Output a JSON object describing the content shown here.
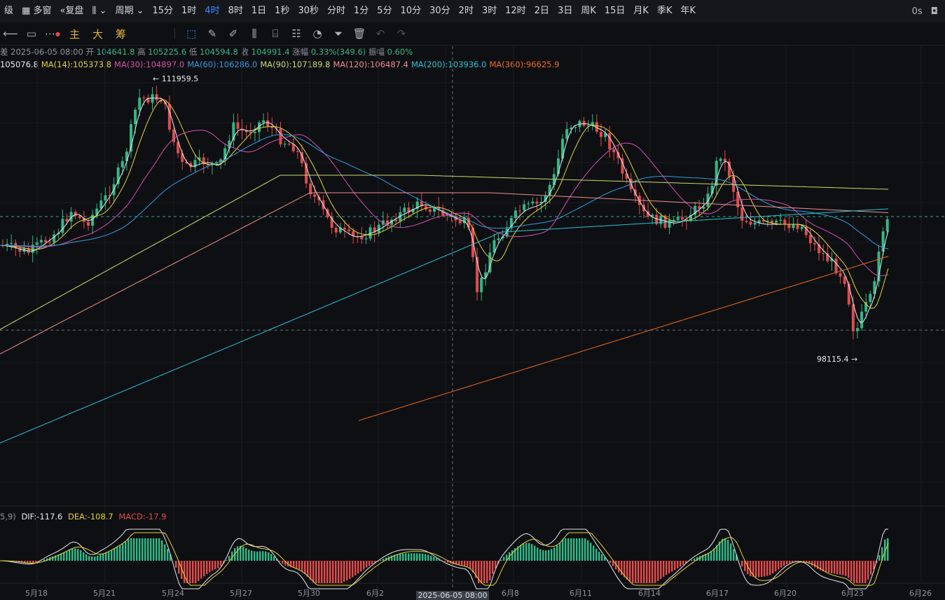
{
  "topbar": {
    "items": [
      "级",
      "多窗",
      "复盘",
      "周期",
      "15分",
      "1时",
      "4时",
      "8时",
      "1日",
      "1秒",
      "30秒",
      "分时",
      "1分",
      "5分",
      "10分",
      "30分",
      "2时",
      "3时",
      "12时",
      "2日",
      "3日",
      "周K",
      "15日",
      "月K",
      "季K",
      "年K"
    ],
    "active": "4时",
    "latency": "0s"
  },
  "toolbar": {
    "indicators": [
      "主",
      "大",
      "筹"
    ]
  },
  "info": {
    "date": "2025-06-05 08:00",
    "open_label": "开",
    "open": "104641.8",
    "high_label": "高",
    "high": "105225.6",
    "low_label": "低",
    "low": "104594.8",
    "close_label": "收",
    "close": "104991.4",
    "change_label": "涨幅",
    "change": "0.33%(349.6)",
    "amp_label": "振幅",
    "amp": "0.60%"
  },
  "ma_legend": [
    {
      "text": "105076.8",
      "color": "#e8eaee"
    },
    {
      "text": "MA(14):105373.8",
      "color": "#e6d23a"
    },
    {
      "text": "MA(30):104897.0",
      "color": "#d54fb0"
    },
    {
      "text": "MA(60):106286.0",
      "color": "#2f9de0"
    },
    {
      "text": "MA(90):107189.8",
      "color": "#c8dc6e"
    },
    {
      "text": "MA(120):106487.4",
      "color": "#ee8e8e"
    },
    {
      "text": "MA(200):103936.0",
      "color": "#23c7d6"
    },
    {
      "text": "MA(360):96625.9",
      "color": "#ec6c1e"
    }
  ],
  "macd_legend": {
    "params": "5,9)",
    "dif": "DIF:-117.6",
    "dea": "DEA:-108.7",
    "macd": "MACD:-17.9"
  },
  "annotations": {
    "high_mark": "111959.5",
    "low_mark": "98115.4"
  },
  "x_labels": [
    "5月18",
    "5月21",
    "5月24",
    "5月27",
    "5月30",
    "6月2",
    "6月8",
    "6月11",
    "6月14",
    "6月17",
    "6月20",
    "6月23",
    "6月26"
  ],
  "cursor_label": "2025-06-05 08:00",
  "colors": {
    "up": "#2fb987",
    "down": "#e04b4b",
    "bg": "#0e0f12",
    "active": "#3d8bff"
  }
}
